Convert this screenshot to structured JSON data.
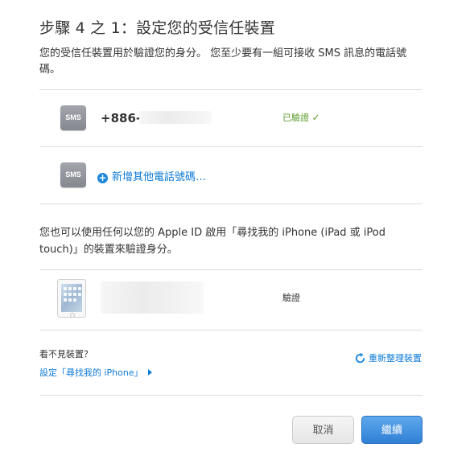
{
  "header": {
    "title": "步驟 4 之 1：設定您的受信任裝置",
    "intro": "您的受信任裝置用於驗證您的身分。 您至少要有一組可接收 SMS 訊息的電話號碼。"
  },
  "sms_devices": {
    "icon_label": "SMS",
    "phone_number": "+886-",
    "verified_label": "已驗證",
    "verified_check": "✓",
    "add_phone_label": "新增其他電話號碼…"
  },
  "find_my_iphone": {
    "description": "您也可以使用任何以您的 Apple ID 啟用「尋找我的 iPhone (iPad 或 iPod touch)」的裝置來驗證身分。",
    "device_icon": "ipad-icon",
    "verify_label": "驗證"
  },
  "footer": {
    "missing_device_label": "看不見裝置？",
    "setup_find_my_iphone_link": "設定「尋找我的 iPhone」",
    "refresh_devices_link": "重新整理裝置"
  },
  "buttons": {
    "cancel_label": "取消",
    "continue_label": "繼續"
  },
  "colors": {
    "link": "#0d7ad6",
    "verified_green": "#5b9a2a",
    "primary_button": "#3a8ddf",
    "divider": "#dddddd"
  }
}
